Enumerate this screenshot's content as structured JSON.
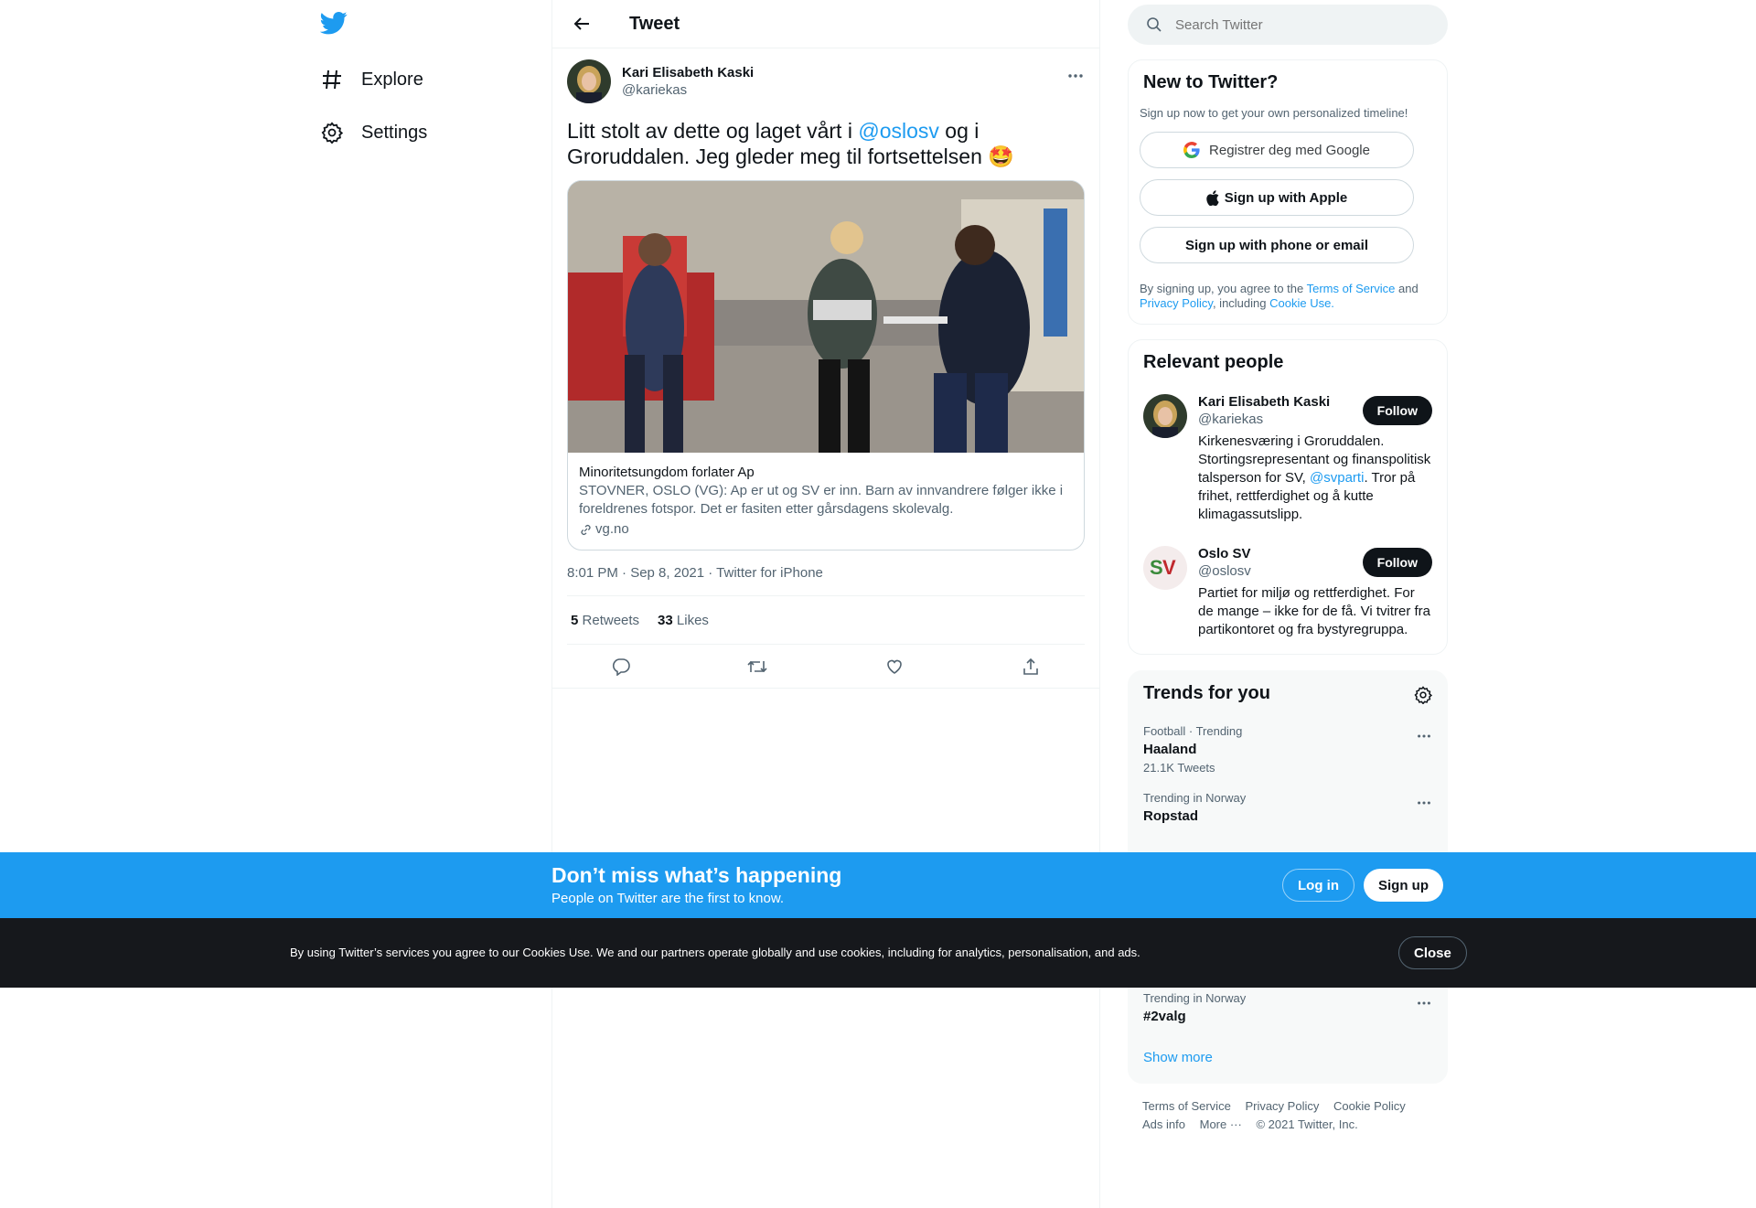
{
  "nav": {
    "logo_icon": "twitter-bird-icon",
    "items": [
      {
        "label": "Explore",
        "icon": "hashtag-icon"
      },
      {
        "label": "Settings",
        "icon": "gear-icon"
      }
    ]
  },
  "header": {
    "title": "Tweet"
  },
  "tweet": {
    "author_name": "Kari Elisabeth Kaski",
    "author_handle": "@kariekas",
    "text_before": "Litt stolt av dette og laget vårt i ",
    "mention": "@oslosv",
    "text_after": " og i Groruddalen. Jeg gleder meg til fortsettelsen 🤩",
    "card": {
      "title": "Minoritetsungdom forlater Ap",
      "description": "STOVNER, OSLO (VG): Ap er ut og SV er inn. Barn av innvandrere følger ikke i foreldrenes fotspor. Det er fasiten etter gårsdagens skolevalg.",
      "domain": "vg.no"
    },
    "meta": "8:01 PM · Sep 8, 2021 · Twitter for iPhone",
    "retweets_count": "5",
    "retweets_label": "Retweets",
    "likes_count": "33",
    "likes_label": "Likes"
  },
  "search": {
    "placeholder": "Search Twitter"
  },
  "signup": {
    "title": "New to Twitter?",
    "subtitle": "Sign up now to get your own personalized timeline!",
    "google_label": "Registrer deg med Google",
    "apple_label": "Sign up with Apple",
    "phone_label": "Sign up with phone or email",
    "legal_1": "By signing up, you agree to the ",
    "legal_tos": "Terms of Service",
    "legal_2": " and ",
    "legal_privacy": "Privacy Policy",
    "legal_3": ", including ",
    "legal_cookie": "Cookie Use."
  },
  "relevant": {
    "title": "Relevant people",
    "people": [
      {
        "name": "Kari Elisabeth Kaski",
        "handle": "@kariekas",
        "bio_before": "Kirkenesværing i Groruddalen. Stortingsrepresentant og finanspolitisk talsperson for SV, ",
        "bio_mention": "@svparti",
        "bio_after": ". Tror på frihet, rettferdighet og å kutte klimagassutslipp.",
        "follow_label": "Follow"
      },
      {
        "name": "Oslo SV",
        "handle": "@oslosv",
        "bio": "Partiet for miljø og rettferdighet. For de mange – ikke for de få. Vi tvitrer fra partikontoret og fra bystyregruppa.",
        "follow_label": "Follow"
      }
    ]
  },
  "trends": {
    "title": "Trends for you",
    "items": [
      {
        "context": "Football · Trending",
        "name": "Haaland",
        "count": "21.1K Tweets"
      },
      {
        "context": "Trending in Norway",
        "name": "Ropstad",
        "count": ""
      },
      {
        "context": "Trending in Norway",
        "name": "#2valg",
        "count": ""
      }
    ],
    "show_more": "Show more"
  },
  "footer": {
    "links": [
      "Terms of Service",
      "Privacy Policy",
      "Cookie Policy",
      "Ads info",
      "More ···"
    ],
    "copyright": "© 2021 Twitter, Inc."
  },
  "banner": {
    "title": "Don’t miss what’s happening",
    "subtitle": "People on Twitter are the first to know.",
    "login_label": "Log in",
    "signup_label": "Sign up"
  },
  "cookie": {
    "text": "By using Twitter’s services you agree to our Cookies Use. We and our partners operate globally and use cookies, including for analytics, personalisation, and ads.",
    "close_label": "Close"
  },
  "colors": {
    "accent": "#1d9bf0",
    "text": "#0f1419",
    "muted": "#536471",
    "cookie_bg": "#16181c"
  }
}
